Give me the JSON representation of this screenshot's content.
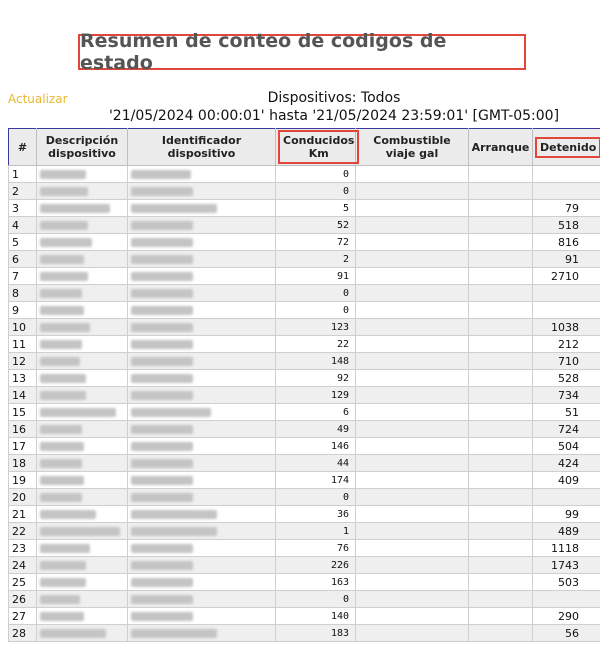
{
  "title": "Resumen de conteo de codigos de estado",
  "refresh_label": "Actualizar",
  "devices_label": "Dispositivos: Todos",
  "date_range": "'21/05/2024 00:00:01' hasta '21/05/2024 23:59:01' [GMT-05:00]",
  "columns": {
    "num": "#",
    "description": "Descripción dispositivo",
    "identifier": "Identificador dispositivo",
    "driven": "Conducidos Km",
    "fuel": "Combustible viaje gal",
    "start": "Arranque",
    "stopped": "Detenido"
  },
  "rows": [
    {
      "n": "1",
      "km": "0",
      "det": ""
    },
    {
      "n": "2",
      "km": "0",
      "det": ""
    },
    {
      "n": "3",
      "km": "5",
      "det": "79"
    },
    {
      "n": "4",
      "km": "52",
      "det": "518"
    },
    {
      "n": "5",
      "km": "72",
      "det": "816"
    },
    {
      "n": "6",
      "km": "2",
      "det": "91"
    },
    {
      "n": "7",
      "km": "91",
      "det": "2710"
    },
    {
      "n": "8",
      "km": "0",
      "det": ""
    },
    {
      "n": "9",
      "km": "0",
      "det": ""
    },
    {
      "n": "10",
      "km": "123",
      "det": "1038"
    },
    {
      "n": "11",
      "km": "22",
      "det": "212"
    },
    {
      "n": "12",
      "km": "148",
      "det": "710"
    },
    {
      "n": "13",
      "km": "92",
      "det": "528"
    },
    {
      "n": "14",
      "km": "129",
      "det": "734"
    },
    {
      "n": "15",
      "km": "6",
      "det": "51"
    },
    {
      "n": "16",
      "km": "49",
      "det": "724"
    },
    {
      "n": "17",
      "km": "146",
      "det": "504"
    },
    {
      "n": "18",
      "km": "44",
      "det": "424"
    },
    {
      "n": "19",
      "km": "174",
      "det": "409"
    },
    {
      "n": "20",
      "km": "0",
      "det": ""
    },
    {
      "n": "21",
      "km": "36",
      "det": "99"
    },
    {
      "n": "22",
      "km": "1",
      "det": "489"
    },
    {
      "n": "23",
      "km": "76",
      "det": "1118"
    },
    {
      "n": "24",
      "km": "226",
      "det": "1743"
    },
    {
      "n": "25",
      "km": "163",
      "det": "503"
    },
    {
      "n": "26",
      "km": "0",
      "det": ""
    },
    {
      "n": "27",
      "km": "140",
      "det": "290"
    },
    {
      "n": "28",
      "km": "183",
      "det": "56"
    }
  ]
}
